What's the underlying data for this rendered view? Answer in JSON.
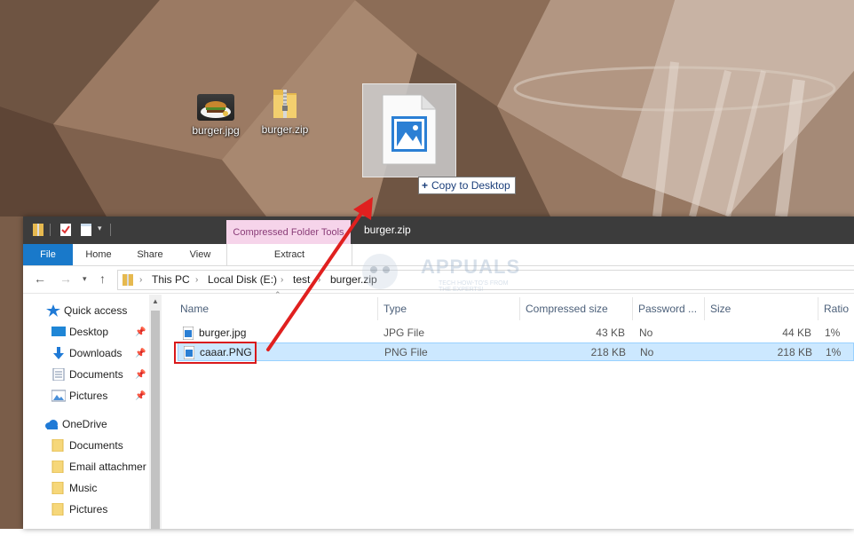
{
  "desktop": {
    "icons": [
      {
        "label": "burger.jpg",
        "icon": "image-thumbnail-icon"
      },
      {
        "label": "burger.zip",
        "icon": "zip-folder-icon"
      }
    ],
    "drag_tooltip": "Copy to Desktop",
    "drag_tooltip_prefix": "+"
  },
  "window": {
    "title": "burger.zip",
    "contextual_tab_group": "Compressed Folder Tools",
    "ribbon_tabs": [
      "File",
      "Home",
      "Share",
      "View",
      "Extract"
    ],
    "accent_color": "#1979ca",
    "contextual_color": "#f6d4ea"
  },
  "address": {
    "crumbs": [
      "This PC",
      "Local Disk (E:)",
      "test",
      "burger.zip"
    ]
  },
  "navpane": {
    "quick_access": "Quick access",
    "quick_items": [
      "Desktop",
      "Downloads",
      "Documents",
      "Pictures"
    ],
    "onedrive": "OneDrive",
    "onedrive_items": [
      "Documents",
      "Email attachmer",
      "Music",
      "Pictures"
    ]
  },
  "columns": [
    "Name",
    "Type",
    "Compressed size",
    "Password ...",
    "Size",
    "Ratio"
  ],
  "files": [
    {
      "name": "burger.jpg",
      "type": "JPG File",
      "compressed": "43 KB",
      "password": "No",
      "size": "44 KB",
      "ratio": "1%"
    },
    {
      "name": "caaar.PNG",
      "type": "PNG File",
      "compressed": "218 KB",
      "password": "No",
      "size": "218 KB",
      "ratio": "1%"
    }
  ],
  "watermark": {
    "name": "APPUALS",
    "tagline": "TECH HOW-TO'S FROM THE EXPERTS!"
  }
}
